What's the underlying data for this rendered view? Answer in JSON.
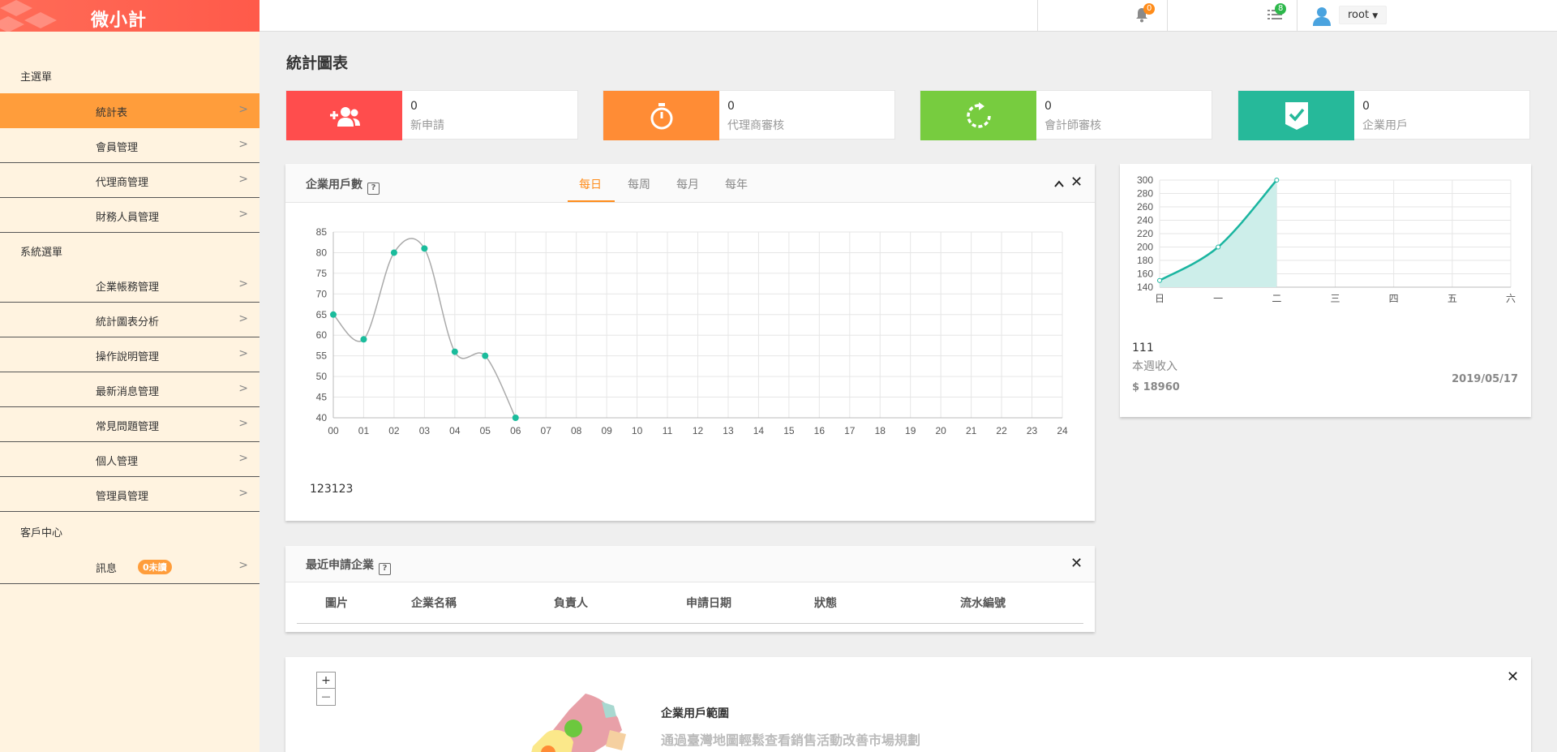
{
  "app": {
    "logo": "微小計"
  },
  "sidebar": {
    "sections": [
      "主選單",
      "系統選單",
      "客戶中心"
    ],
    "items": [
      {
        "label": "統計表"
      },
      {
        "label": "會員管理"
      },
      {
        "label": "代理商管理"
      },
      {
        "label": "財務人員管理"
      },
      {
        "label": "企業帳務管理"
      },
      {
        "label": "統計圖表分析"
      },
      {
        "label": "操作說明管理"
      },
      {
        "label": "最新消息管理"
      },
      {
        "label": "常見問題管理"
      },
      {
        "label": "個人管理"
      },
      {
        "label": "管理員管理"
      },
      {
        "label": "訊息"
      }
    ],
    "unread_badge": "0未讀"
  },
  "topbar": {
    "notifications": "0",
    "tasks": "8",
    "user": "root"
  },
  "page": {
    "title": "統計圖表"
  },
  "stats": [
    {
      "value": "0",
      "label": "新申請",
      "color": "#ff4d4d",
      "icon": "add-user-icon"
    },
    {
      "value": "0",
      "label": "代理商審核",
      "color": "#ff8c35",
      "icon": "stopwatch-icon"
    },
    {
      "value": "0",
      "label": "會計師審核",
      "color": "#77cc3f",
      "icon": "refresh-icon"
    },
    {
      "value": "0",
      "label": "企業用戶",
      "color": "#26b99a",
      "icon": "check-shield-icon"
    }
  ],
  "user_chart_panel": {
    "title": "企業用戶數",
    "help": "?",
    "tabs": [
      "每日",
      "每周",
      "每月",
      "每年"
    ],
    "active_tab": 0,
    "footer": "123123"
  },
  "revenue_panel": {
    "count": "111",
    "label": "本週收入",
    "amount": "$ 18960",
    "date": "2019/05/17"
  },
  "recent_panel": {
    "title": "最近申請企業",
    "help": "?",
    "columns": [
      "圖片",
      "企業名稱",
      "負責人",
      "申請日期",
      "狀態",
      "流水編號"
    ]
  },
  "map_panel": {
    "zoom_in": "+",
    "zoom_out": "—",
    "title": "企業用戶範圍",
    "subtitle": "通過臺灣地圖輕鬆查看銷售活動改善市場規劃"
  },
  "chart_data": [
    {
      "type": "line",
      "categories": [
        "00",
        "01",
        "02",
        "03",
        "04",
        "05",
        "06",
        "07",
        "08",
        "09",
        "10",
        "11",
        "12",
        "13",
        "14",
        "15",
        "16",
        "17",
        "18",
        "19",
        "20",
        "21",
        "22",
        "23",
        "24"
      ],
      "values": [
        65,
        59,
        80,
        81,
        56,
        55,
        40
      ],
      "ylim": [
        40,
        85
      ],
      "yticks": [
        40,
        45,
        50,
        55,
        60,
        65,
        70,
        75,
        80,
        85
      ],
      "grid": true,
      "line_color": "#aaaaaa",
      "point_color": "#1abc9c"
    },
    {
      "type": "area",
      "categories": [
        "日",
        "一",
        "二",
        "三",
        "四",
        "五",
        "六"
      ],
      "values": [
        150,
        200,
        300
      ],
      "ylim": [
        140,
        300
      ],
      "yticks": [
        140,
        160,
        180,
        200,
        220,
        240,
        260,
        280,
        300
      ],
      "grid": true,
      "line_color": "#1ab5a0",
      "fill_color": "#cdeeea"
    }
  ]
}
